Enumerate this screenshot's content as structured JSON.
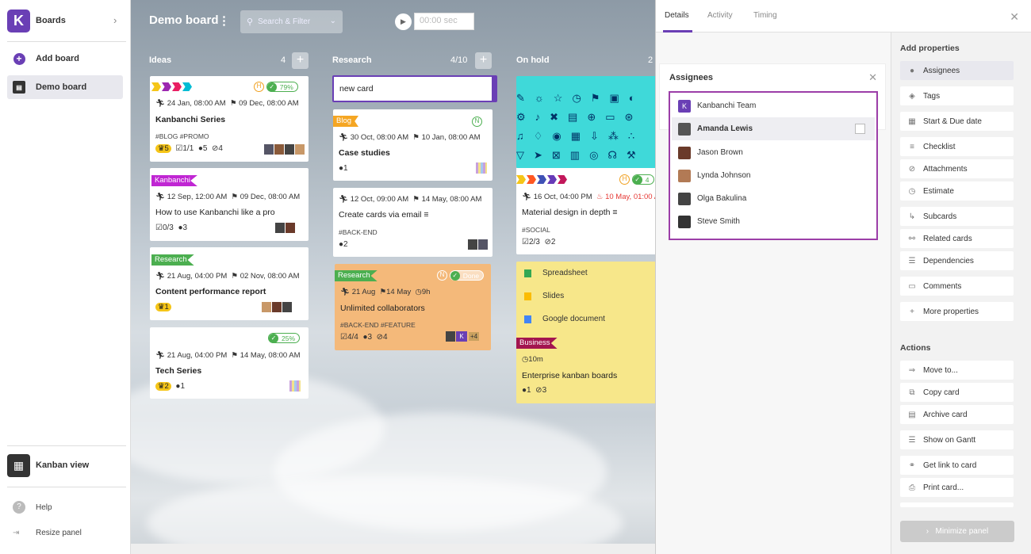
{
  "sidebar": {
    "title": "Boards",
    "add_board": "Add board",
    "demo_board": "Demo board",
    "kanban_view": "Kanban view",
    "help": "Help",
    "resize_panel": "Resize panel"
  },
  "board": {
    "title": "Demo board",
    "search_placeholder": "Search & Filter",
    "timer": "00:00 sec",
    "columns": [
      {
        "title": "Ideas",
        "count": "4"
      },
      {
        "title": "Research",
        "count": "4/10"
      },
      {
        "title": "On hold",
        "count": "2"
      }
    ]
  },
  "cards": {
    "c1": {
      "pct": "79%",
      "start": "24 Jan, 08:00 AM",
      "due": "09 Dec, 08:00 AM",
      "title": "Kanbanchi Series",
      "tags": "#BLOG  #PROMO",
      "likes": "5",
      "check": "1/1",
      "comments": "5",
      "attach": "4"
    },
    "c2": {
      "tag": "Kanbanchi",
      "start": "12 Sep, 12:00 AM",
      "due": "09 Dec, 08:00 AM",
      "title": "How to use Kanbanchi like a pro",
      "check": "0/3",
      "comments": "3"
    },
    "c3": {
      "tag": "Research",
      "start": "21 Aug, 04:00 PM",
      "due": "02 Nov, 08:00 AM",
      "title": "Content performance report",
      "likes": "1"
    },
    "c4": {
      "pct": "25%",
      "start": "21 Aug, 04:00 PM",
      "due": "14 May, 08:00 AM",
      "title": "Tech Series",
      "likes": "2",
      "comments": "1"
    },
    "r0": {
      "value": "new card"
    },
    "r1": {
      "tag": "Blog",
      "start": "30 Oct, 08:00 AM",
      "due": "10 Jan, 08:00 AM",
      "title": "Case studies",
      "comments": "1"
    },
    "r2": {
      "start": "12 Oct, 09:00 AM",
      "due": "14 May, 08:00 AM",
      "title": "Create cards via email",
      "tags": "#BACK-END",
      "comments": "2"
    },
    "r3": {
      "tag": "Research",
      "done": "Done",
      "start": "21 Aug",
      "due": "14 May",
      "est": "9h",
      "title": "Unlimited collaborators",
      "tags": "#BACK-END  #FEATURE",
      "check": "4/4",
      "comments": "3",
      "attach": "4",
      "more": "+4"
    },
    "h1": {
      "start": "16 Oct, 04:00 PM",
      "due": "10 May, 01:00 AM",
      "title": "Material design in depth",
      "tags": "#SOCIAL",
      "check": "2/3",
      "attach": "2",
      "pct": "4"
    },
    "h2": {
      "f1": "Spreadsheet",
      "f2": "Slides",
      "f3": "Google document",
      "tag": "Business",
      "est": "10m",
      "title": "Enterprise kanban boards",
      "comments": "1",
      "attach": "3"
    }
  },
  "panel": {
    "tabs": [
      "Details",
      "Activity",
      "Timing"
    ],
    "assignees": {
      "title": "Assignees",
      "search_value": "|",
      "people": [
        "Kanbanchi Team",
        "Amanda Lewis",
        "Jason Brown",
        "Lynda Johnson",
        "Olga Bakulina",
        "Steve Smith"
      ]
    },
    "add_properties": "Add properties",
    "props": [
      "Assignees",
      "Tags",
      "Start & Due date",
      "Checklist",
      "Attachments",
      "Estimate",
      "Subcards",
      "Related cards",
      "Dependencies",
      "Comments",
      "More properties"
    ],
    "actions_title": "Actions",
    "actions": [
      "Move to...",
      "Copy card",
      "Archive card",
      "Show on Gantt",
      "Get link to card",
      "Print card..."
    ],
    "minimize": "Minimize panel"
  },
  "colors": {
    "brand": "#6a3fb5",
    "highlight": "#9c3ea8",
    "success": "#4caf50",
    "warning": "#f0a020",
    "note": "#f7e78a",
    "orange_card": "#f4b97a"
  }
}
